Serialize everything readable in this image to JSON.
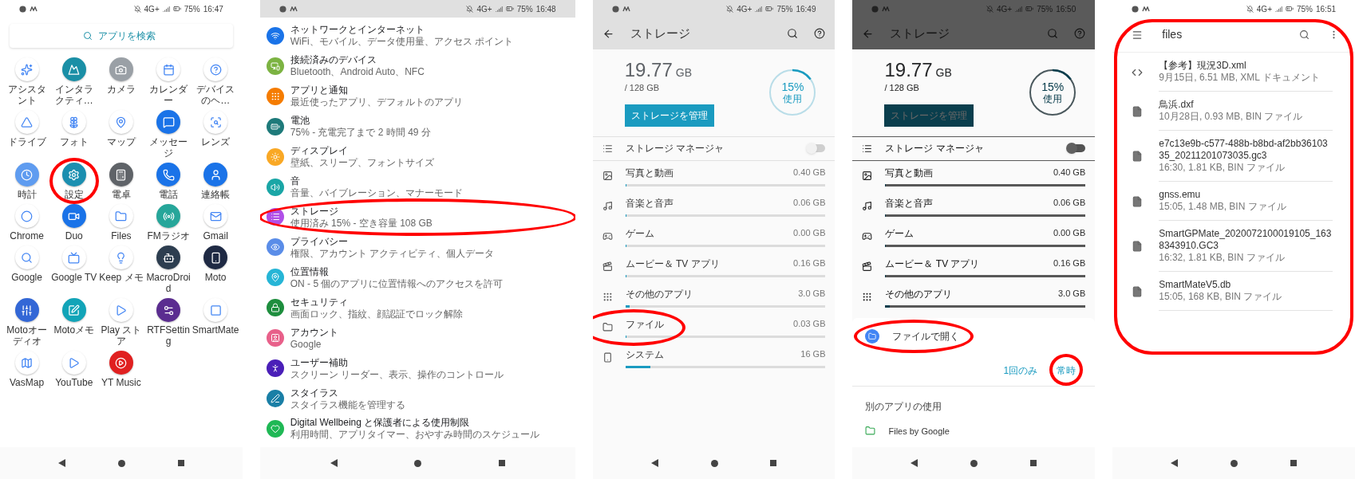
{
  "screens": [
    {
      "kind": "launcher",
      "circled": false,
      "status": {
        "network": "4G+",
        "battery": "75%",
        "time": "16:47"
      },
      "search": {
        "placeholder": "アプリを検索"
      },
      "apps": [
        {
          "label": "アシスタント",
          "color": "#ffffff",
          "circled": false
        },
        {
          "label": "インタラクティ…",
          "color": "#1a8fa6",
          "circled": false
        },
        {
          "label": "カメラ",
          "color": "#9aa0a6",
          "circled": false
        },
        {
          "label": "カレンダー",
          "color": "#ffffff",
          "circled": false
        },
        {
          "label": "デバイスのヘ…",
          "color": "#ffffff",
          "circled": false
        },
        {
          "label": "ドライブ",
          "color": "#ffffff",
          "circled": false
        },
        {
          "label": "フォト",
          "color": "#ffffff",
          "circled": false
        },
        {
          "label": "マップ",
          "color": "#ffffff",
          "circled": false
        },
        {
          "label": "メッセージ",
          "color": "#1a73e8",
          "circled": false
        },
        {
          "label": "レンズ",
          "color": "#ffffff",
          "circled": false
        },
        {
          "label": "時計",
          "color": "#5f9cf0",
          "circled": false
        },
        {
          "label": "設定",
          "color": "#1b8fb0",
          "circled": true
        },
        {
          "label": "電卓",
          "color": "#5f6368",
          "circled": false
        },
        {
          "label": "電話",
          "color": "#1a73e8",
          "circled": false
        },
        {
          "label": "連絡帳",
          "color": "#1a73e8",
          "circled": false
        },
        {
          "label": "Chrome",
          "color": "#ffffff",
          "circled": false
        },
        {
          "label": "Duo",
          "color": "#1a73e8",
          "circled": false
        },
        {
          "label": "Files",
          "color": "#ffffff",
          "circled": false
        },
        {
          "label": "FMラジオ",
          "color": "#26a69a",
          "circled": false
        },
        {
          "label": "Gmail",
          "color": "#ffffff",
          "circled": false
        },
        {
          "label": "Google",
          "color": "#ffffff",
          "circled": false
        },
        {
          "label": "Google TV",
          "color": "#ffffff",
          "circled": false
        },
        {
          "label": "Keep メモ",
          "color": "#ffffff",
          "circled": false
        },
        {
          "label": "MacroDroid",
          "color": "#2d3e50",
          "circled": false
        },
        {
          "label": "Moto",
          "color": "#1f2a44",
          "circled": false
        },
        {
          "label": "Motoオーディオ",
          "color": "#3367d6",
          "circled": false
        },
        {
          "label": "Motoメモ",
          "color": "#12a4b8",
          "circled": false
        },
        {
          "label": "Play ストア",
          "color": "#ffffff",
          "circled": false
        },
        {
          "label": "RTFSetting",
          "color": "#5b2d90",
          "circled": false
        },
        {
          "label": "SmartMate",
          "color": "#ffffff",
          "circled": false
        },
        {
          "label": "VasMap",
          "color": "#ffffff",
          "circled": false
        },
        {
          "label": "YouTube",
          "color": "#ffffff",
          "circled": false
        },
        {
          "label": "YT Music",
          "color": "#e02020",
          "circled": false
        }
      ]
    },
    {
      "kind": "settings",
      "circled": false,
      "status": {
        "network": "4G+",
        "battery": "75%",
        "time": "16:48"
      },
      "items": [
        {
          "title": "ネットワークとインターネット",
          "subtitle": "WiFi、モバイル、データ使用量、アクセス ポイント",
          "color": "#1a73e8",
          "circled": false
        },
        {
          "title": "接続済みのデバイス",
          "subtitle": "Bluetooth、Android Auto、NFC",
          "color": "#7cb342",
          "circled": false
        },
        {
          "title": "アプリと通知",
          "subtitle": "最近使ったアプリ、デフォルトのアプリ",
          "color": "#f57c00",
          "circled": false
        },
        {
          "title": "電池",
          "subtitle": "75% - 充電完了まで 2 時間 49 分",
          "color": "#1e7a7a",
          "circled": false
        },
        {
          "title": "ディスプレイ",
          "subtitle": "壁紙、スリープ、フォントサイズ",
          "color": "#f9a825",
          "circled": false
        },
        {
          "title": "音",
          "subtitle": "音量、バイブレーション、マナーモード",
          "color": "#1aa6a6",
          "circled": false
        },
        {
          "title": "ストレージ",
          "subtitle": "使用済み 15% - 空き容量 108 GB",
          "color": "#b04fe8",
          "circled": true
        },
        {
          "title": "プライバシー",
          "subtitle": "権限、アカウント アクティビティ、個人データ",
          "color": "#5a8de8",
          "circled": false
        },
        {
          "title": "位置情報",
          "subtitle": "ON - 5 個のアプリに位置情報へのアクセスを許可",
          "color": "#26b5d6",
          "circled": false
        },
        {
          "title": "セキュリティ",
          "subtitle": "画面ロック、指紋、顔認証でロック解除",
          "color": "#1e8e3e",
          "circled": false
        },
        {
          "title": "アカウント",
          "subtitle": "Google",
          "color": "#e8608a",
          "circled": false
        },
        {
          "title": "ユーザー補助",
          "subtitle": "スクリーン リーダー、表示、操作のコントロール",
          "color": "#4a1fb8",
          "circled": false
        },
        {
          "title": "スタイラス",
          "subtitle": "スタイラス機能を管理する",
          "color": "#1a7fa6",
          "circled": false
        },
        {
          "title": "Digital Wellbeing と保護者による使用制限",
          "subtitle": "利用時間、アプリタイマー、おやすみ時間のスケジュール",
          "color": "#1fb855",
          "circled": false
        }
      ]
    },
    {
      "kind": "storage",
      "circled": false,
      "dimmed": false,
      "status": {
        "network": "4G+",
        "battery": "75%",
        "time": "16:49"
      },
      "storage": {
        "title": "ストレージ",
        "used": "19.77",
        "unit": "GB",
        "total": "/ 128 GB",
        "manage_button": "ストレージを管理",
        "percent": "15%",
        "percent_label": "使用",
        "level": 0.15,
        "manager": {
          "label": "ストレージ マネージャ",
          "on": false
        },
        "categories": [
          {
            "label": "写真と動画",
            "size": "0.40 GB",
            "level": 0.003,
            "circled": false
          },
          {
            "label": "音楽と音声",
            "size": "0.06 GB",
            "level": 0.0005,
            "circled": false
          },
          {
            "label": "ゲーム",
            "size": "0.00 GB",
            "level": 0.0001,
            "circled": false
          },
          {
            "label": "ムービー＆ TV アプリ",
            "size": "0.16 GB",
            "level": 0.001,
            "circled": false
          },
          {
            "label": "その他のアプリ",
            "size": "3.0 GB",
            "level": 0.023,
            "circled": false
          },
          {
            "label": "ファイル",
            "size": "0.03 GB",
            "level": 0.0002,
            "circled": true
          },
          {
            "label": "システム",
            "size": "16 GB",
            "level": 0.125,
            "circled": false
          }
        ]
      }
    },
    {
      "kind": "storage",
      "circled": false,
      "dimmed": true,
      "status": {
        "network": "4G+",
        "battery": "75%",
        "time": "16:50"
      },
      "storage": {
        "title": "ストレージ",
        "used": "19.77",
        "unit": "GB",
        "total": "/ 128 GB",
        "manage_button": "ストレージを管理",
        "percent": "15%",
        "percent_label": "使用",
        "level": 0.15,
        "manager": {
          "label": "ストレージ マネージャ",
          "on": false
        },
        "categories": [
          {
            "label": "写真と動画",
            "size": "0.40 GB",
            "level": 0.003,
            "circled": false
          },
          {
            "label": "音楽と音声",
            "size": "0.06 GB",
            "level": 0.0005,
            "circled": false
          },
          {
            "label": "ゲーム",
            "size": "0.00 GB",
            "level": 0.0001,
            "circled": false
          },
          {
            "label": "ムービー＆ TV アプリ",
            "size": "0.16 GB",
            "level": 0.001,
            "circled": false
          },
          {
            "label": "その他のアプリ",
            "size": "3.0 GB",
            "level": 0.023,
            "circled": false
          }
        ]
      },
      "sheet": {
        "app": {
          "label": "ファイルで開く",
          "circled": true
        },
        "buttons": [
          {
            "label": "1回のみ",
            "circled": false
          },
          {
            "label": "常時",
            "circled": true
          }
        ],
        "other_heading": "別のアプリの使用",
        "other_apps": [
          {
            "label": "Files by Google"
          }
        ]
      }
    },
    {
      "kind": "files",
      "circled": true,
      "status": {
        "network": "4G+",
        "battery": "75%",
        "time": "16:51"
      },
      "title": "files",
      "files": [
        {
          "kind": "code",
          "name": "【参考】現況3D.xml",
          "meta": "9月15日, 6.51 MB, XML ドキュメント"
        },
        {
          "kind": "file",
          "name": "鳥浜.dxf",
          "meta": "10月28日, 0.93 MB, BIN ファイル"
        },
        {
          "kind": "file",
          "name": "e7c13e9b-c577-488b-b8bd-af2bb3610335_20211201073035.gc3",
          "meta": "16:30, 1.81 KB, BIN ファイル"
        },
        {
          "kind": "file",
          "name": "gnss.emu",
          "meta": "15:05, 1.48 MB, BIN ファイル"
        },
        {
          "kind": "file",
          "name": "SmartGPMate_2020072100019105_1638343910.GC3",
          "meta": "16:32, 1.81 KB, BIN ファイル"
        },
        {
          "kind": "file",
          "name": "SmartMateV5.db",
          "meta": "15:05, 168 KB, BIN ファイル"
        }
      ]
    }
  ]
}
